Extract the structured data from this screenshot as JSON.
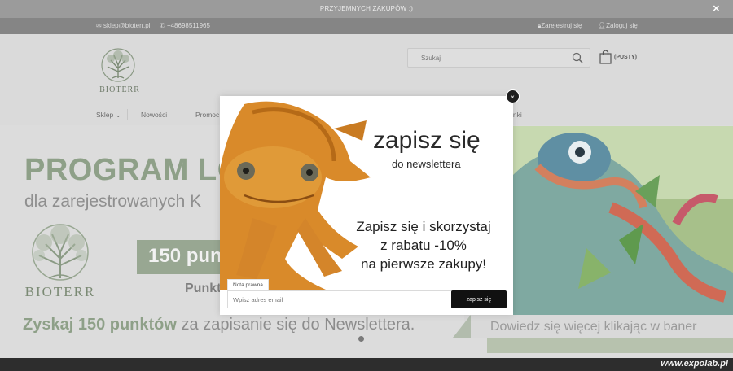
{
  "topbar": {
    "message": "PRZYJEMNYCH ZAKUPÓW :)",
    "close_label": "✕"
  },
  "contact": {
    "email": "sklep@bioterr.pl",
    "phone": "+48698511965",
    "register": "Zarejestruj się",
    "login": "Zaloguj się"
  },
  "header": {
    "logo_text": "BIOTERR",
    "search_placeholder": "Szukaj",
    "cart_label": "(PUSTY)"
  },
  "nav": [
    {
      "label": "Sklep ⌄"
    },
    {
      "label": "Nowości"
    },
    {
      "label": "Promoc"
    },
    {
      "label": "inki"
    }
  ],
  "banner": {
    "title": "PROGRAM LO",
    "subtitle": "dla zarejestrowanych K",
    "logo_text": "BIOTERR",
    "points_label": "150 pun",
    "punk_text": "Punkt",
    "cta_bold": "Zyskaj 150 punktów",
    "cta_rest": " za zapisanie się do Newslettera.",
    "more_text": "Dowiedz się więcej klikając w baner"
  },
  "modal": {
    "close_label": "×",
    "heading": "zapisz się",
    "subheading": "do newslettera",
    "offer_lines": [
      "Zapisz się i skorzystaj",
      "z rabatu -10%",
      "na pierwsze zakupy!"
    ],
    "legal_tab": "Nota prawna",
    "email_placeholder": "Wpisz adres email",
    "submit_label": "zapisz się"
  },
  "watermark": "www.expolab.pl",
  "colors": {
    "brand_green": "#8ea088",
    "overlay_gray": "#9b9b9b",
    "button_black": "#111111"
  }
}
